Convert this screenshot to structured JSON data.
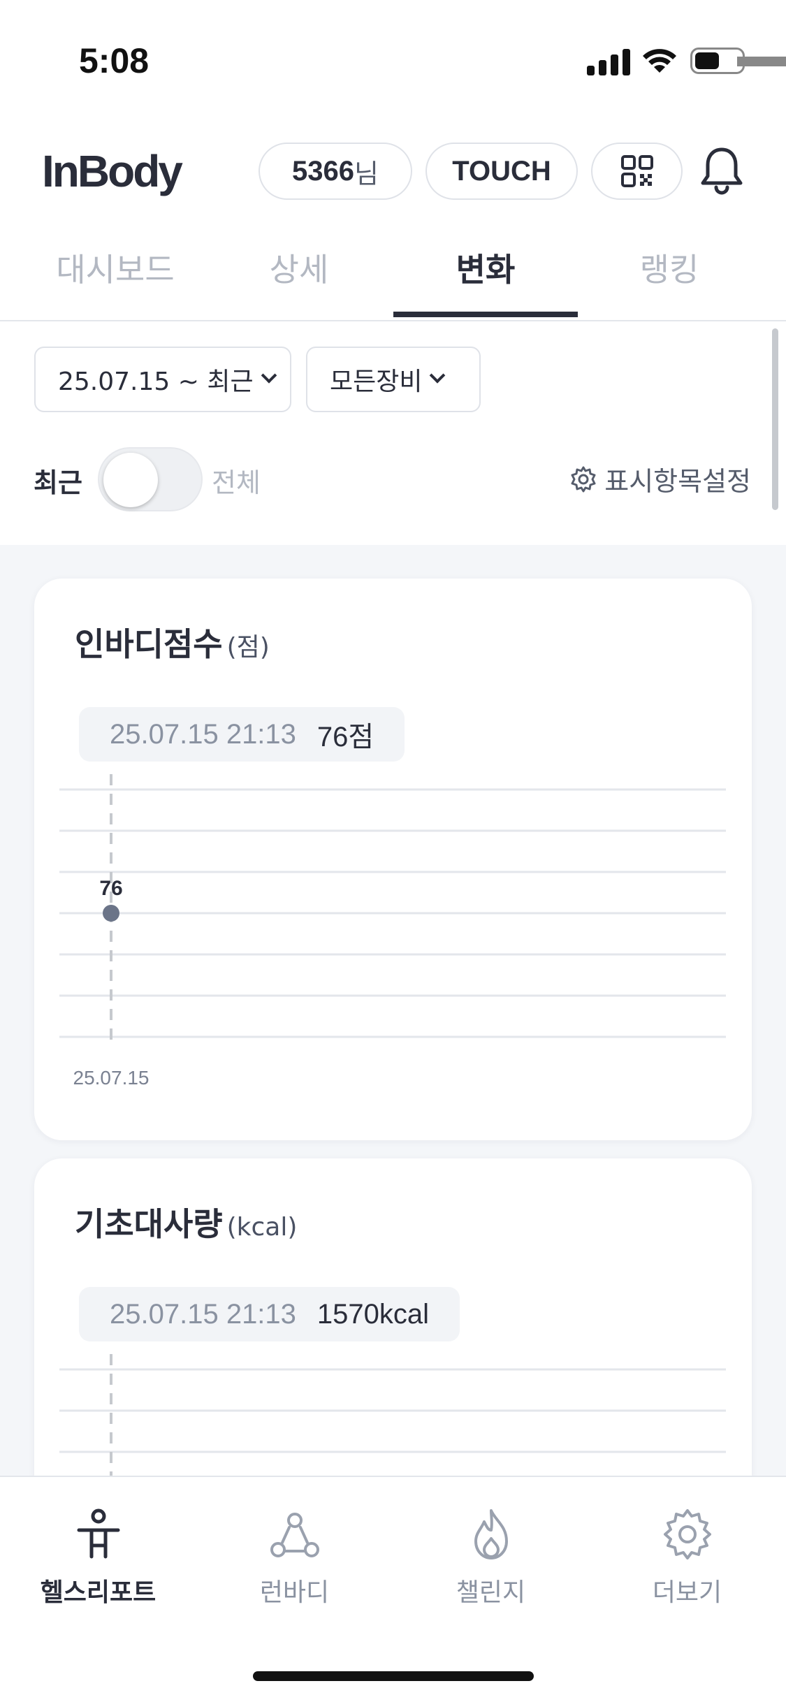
{
  "status_bar": {
    "time": "5:08"
  },
  "header": {
    "logo": "InBody",
    "user_id": "5366",
    "user_suffix": "님",
    "touch_label": "TOUCH",
    "qr_icon": "qr-code-icon",
    "bell_icon": "bell-icon"
  },
  "tabs": [
    {
      "label": "대시보드",
      "active": false
    },
    {
      "label": "상세",
      "active": false
    },
    {
      "label": "변화",
      "active": true
    },
    {
      "label": "랭킹",
      "active": false
    }
  ],
  "filters": {
    "date_range": "25.07.15 ~ 최근",
    "device": "모든장비",
    "toggle_left": "최근",
    "toggle_right": "전체",
    "toggle_on": false,
    "settings_label": "표시항목설정"
  },
  "cards": [
    {
      "title": "인바디점수",
      "unit": "(점)",
      "tooltip_date": "25.07.15 21:13",
      "tooltip_value": "76점"
    },
    {
      "title": "기초대사량",
      "unit": "(kcal)",
      "tooltip_date": "25.07.15 21:13",
      "tooltip_value": "1570kcal"
    }
  ],
  "chart_data": [
    {
      "type": "scatter",
      "x": [
        "25.07.15"
      ],
      "y": [
        76
      ],
      "point_labels": [
        "76"
      ],
      "title": "인바디점수",
      "ylabel": "(점)",
      "grid": true,
      "accent": "#6b7488"
    },
    {
      "type": "scatter",
      "x": [
        "25.07.15"
      ],
      "y": [
        1570
      ],
      "title": "기초대사량",
      "ylabel": "(kcal)",
      "grid": true
    }
  ],
  "bottom_nav": [
    {
      "label": "헬스리포트",
      "icon": "person-icon",
      "active": true
    },
    {
      "label": "런바디",
      "icon": "runbody-icon",
      "active": false
    },
    {
      "label": "챌린지",
      "icon": "flame-icon",
      "active": false
    },
    {
      "label": "더보기",
      "icon": "gear-icon",
      "active": false
    }
  ],
  "colors": {
    "primary": "#2a2d3a",
    "muted": "#b3b8c2",
    "background": "#f4f6f9",
    "point": "#6b7488"
  }
}
